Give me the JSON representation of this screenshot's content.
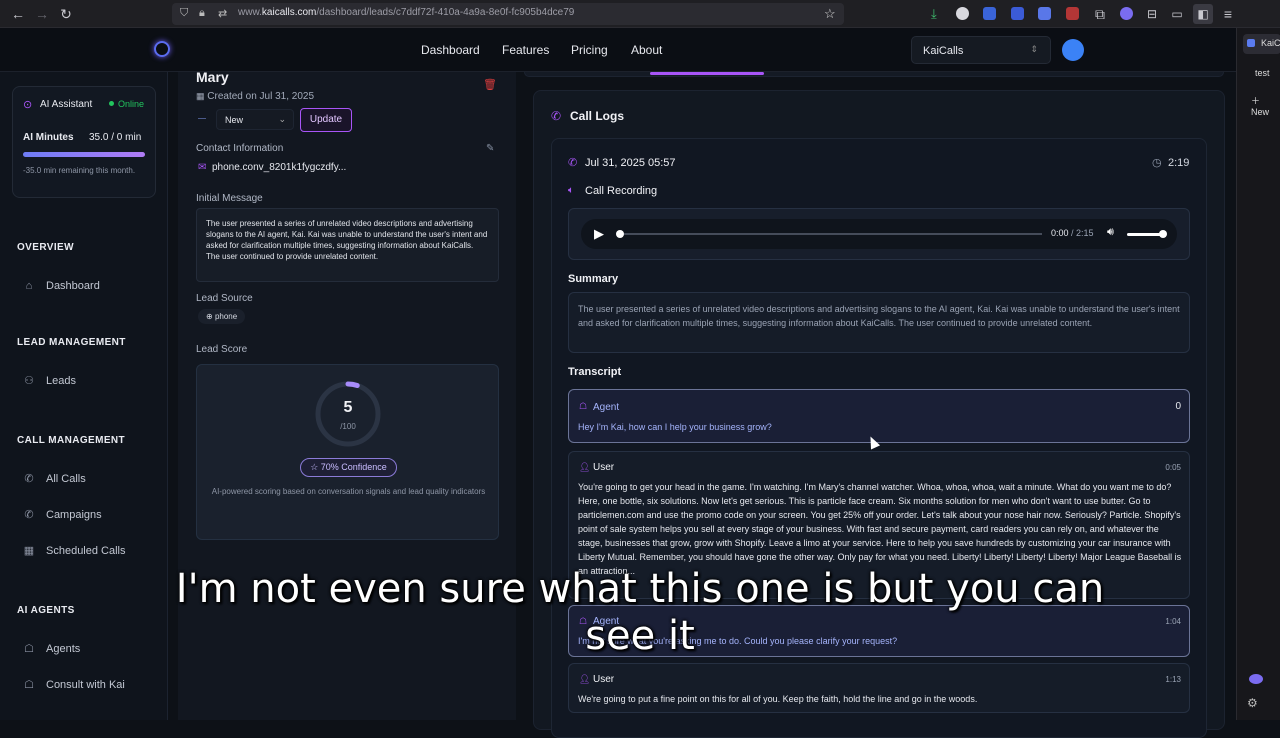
{
  "browser": {
    "url_prefix": "www.",
    "url_domain": "kaicalls.com",
    "url_path": "/dashboard/leads/c7ddf72f-410a-4a9a-8e0f-fc905b4dce79",
    "side_tabs": [
      "KaiC",
      "test",
      "New"
    ]
  },
  "nav": {
    "links": [
      "Dashboard",
      "Features",
      "Pricing",
      "About"
    ],
    "workspace": "KaiCalls"
  },
  "sidebar": {
    "assistant_label": "AI Assistant",
    "assistant_status": "Online",
    "minutes_label": "AI Minutes",
    "minutes_value": "35.0 / 0 min",
    "minutes_note": "-35.0 min remaining this month.",
    "sections": [
      {
        "title": "OVERVIEW",
        "items": [
          "Dashboard"
        ]
      },
      {
        "title": "LEAD MANAGEMENT",
        "items": [
          "Leads"
        ]
      },
      {
        "title": "CALL MANAGEMENT",
        "items": [
          "All Calls",
          "Campaigns",
          "Scheduled Calls"
        ]
      },
      {
        "title": "AI AGENTS",
        "items": [
          "Agents",
          "Consult with Kai"
        ]
      }
    ]
  },
  "lead": {
    "name": "Mary",
    "created": "Created on Jul 31, 2025",
    "status_value": "New",
    "update_label": "Update",
    "contact_label": "Contact Information",
    "contact_value": "phone.conv_8201k1fygczdfy...",
    "initial_label": "Initial Message",
    "initial_text": "The user presented a series of unrelated video descriptions and advertising slogans to the AI agent, Kai. Kai was unable to understand the user's intent and asked for clarification multiple times, suggesting information about KaiCalls. The user continued to provide unrelated content.",
    "source_label": "Lead Source",
    "source_value": "phone",
    "score_label": "Lead Score",
    "score_value": "5",
    "score_max": "/100",
    "score_fraction": 0.05,
    "confidence": "☆ 70% Confidence",
    "score_note": "AI-powered scoring based on conversation signals and lead quality indicators"
  },
  "calls": {
    "title": "Call Logs",
    "date": "Jul 31, 2025 05:57",
    "duration": "2:19",
    "recording_label": "Call Recording",
    "audio_time": "0:00",
    "audio_total": " / 2:15",
    "summary_label": "Summary",
    "summary_text": "The user presented a series of unrelated video descriptions and advertising slogans to the AI agent, Kai. Kai was unable to understand the user's intent and asked for clarification multiple times, suggesting information about KaiCalls. The user continued to provide unrelated content.",
    "transcript_label": "Transcript",
    "transcript": [
      {
        "speaker": "Agent",
        "time": "0",
        "text": "Hey I'm Kai, how can I help your business grow?"
      },
      {
        "speaker": "User",
        "time": "0:05",
        "text": "You're going to get your head in the game. I'm watching. I'm Mary's channel watcher. Whoa, whoa, whoa, wait a minute. What do you want me to do? Here, one bottle, six solutions. Now let's get serious. This is particle face cream. Six months solution for men who don't want to use butter. Go to particlemen.com and use the promo code on your screen. You get 25% off your order. Let's talk about your nose hair now. Seriously? Particle. Shopify's point of sale system helps you sell at every stage of your business. With fast and secure payment, card readers you can rely on, and whatever the stage, businesses that grow, grow with Shopify. Leave a limo at your service. Here to help you save hundreds by customizing your car insurance with Liberty Mutual. Remember, you should have gone the other way. Only pay for what you need. Liberty! Liberty! Liberty! Liberty! Major League Baseball is an attraction..."
      },
      {
        "speaker": "Agent",
        "time": "1:04",
        "text": "I'm not sure what you're asking me to do. Could you please clarify your request?"
      },
      {
        "speaker": "User",
        "time": "1:13",
        "text": "We're going to put a fine point on this for all of you. Keep the faith, hold the line and go in the woods."
      }
    ]
  },
  "caption": {
    "line1": "I'm not even sure what this one is but you can",
    "line2": "see it"
  },
  "colors": {
    "accent": "#a855f7",
    "online": "#22c55e",
    "avatar": "#3b82f6"
  }
}
